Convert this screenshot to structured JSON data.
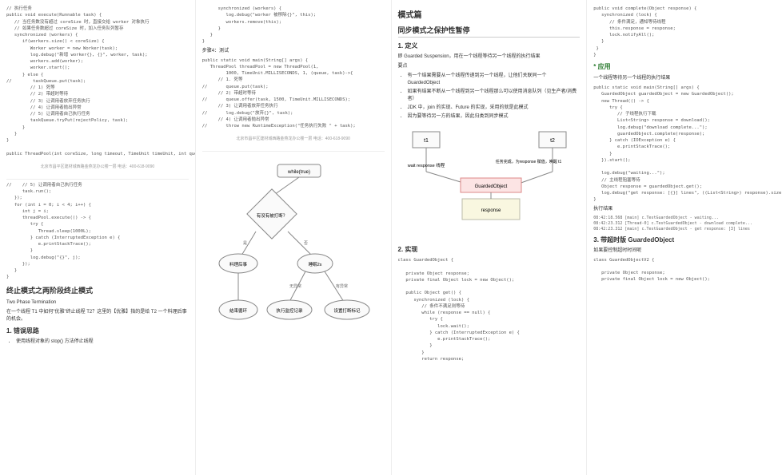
{
  "col1": {
    "code1": "// 执行任务\npublic void execute(Runnable task) {\n   // 当任务数没有超过 coreSize 时，直接交给 worker 对象执行\n   // 如果任务数超过 coreSize 时，加入任务队列暂存\n   synchronized (workers) {\n      if(workers.size() < coreSize) {\n         Worker worker = new Worker(task);\n         log.debug(\"新增 worker{}, {}\", worker, task);\n         workers.add(worker);\n         worker.start();\n      } else {\n//        taskQueue.put(task);\n         // 1) 死等\n         // 2) 带超时等待\n         // 3) 让调用者放弃任务执行\n         // 4) 让调用者抛出异常\n         // 5) 让调用者自己执行任务\n         taskQueue.tryPut(rejectPolicy, task);\n      }\n   }\n}\n\npublic ThreadPool(int coreSize, long timeout, TimeUnit timeUnit, int queueCapcity,",
    "footer1": "北京市昌平区建材城西路金燕龙办公楼一层   电话：400-618-9090",
    "code2": "//    // 5) 让调用者自己执行任务\n      task.run();\n   });\n   for (int i = 0; i < 4; i++) {\n      int j = i;\n      threadPool.execute(() -> {\n         try {\n            Thread.sleep(1000L);\n         } catch (InterruptedException e) {\n            e.printStackTrace();\n         }\n         log.debug(\"{}\", j);\n      });\n   }\n}",
    "h2_1": "终止模式之两阶段终止模式",
    "p1": "Two Phase Termination",
    "p2": "在一个线程 T1 中如何\"优雅\"终止线程 T2？这里的【优雅】指的是给 T2 一个料理后事的机会。",
    "h3_1": "1. 错误思路",
    "li1": "使用线程对象的 stop() 方法停止线程"
  },
  "col2": {
    "code1": "      synchronized (workers) {\n         log.debug(\"worker 被移除{}\", this);\n         workers.remove(this);\n      }\n   }\n}",
    "step": "步骤4：测试",
    "code2": "public static void main(String[] args) {\n   ThreadPool threadPool = new ThreadPool(1,\n         1000, TimeUnit.MILLISECONDS, 1, (queue, task)->{\n      // 1. 死等\n//       queue.put(task);\n      // 2) 带超时等待\n//       queue.offer(task, 1500, TimeUnit.MILLISECONDS);\n      // 3) 让调用者放弃任务执行\n//       log.debug(\"放弃{}\", task);\n      // 4) 让调用者抛出异常\n//       throw new RuntimeException(\"任务执行失败 \" + task);",
    "footer1": "北京市昌平区建材城西路金燕龙办公楼一层   电话：400-618-9090",
    "flow": {
      "top": "while(true)",
      "d1": "有没有被打断？",
      "yes": "是",
      "no": "否",
      "left": "料理后事",
      "right": "睡眠2s",
      "noex": "无异常",
      "hasex": "有异常",
      "b1": "结束循环",
      "b2": "执行监控记录",
      "b3": "设置打断标记"
    }
  },
  "col3": {
    "title": "模式篇",
    "sub1": "同步模式之保护性暂停",
    "h3_1": "1. 定义",
    "p1": "即 Guarded Suspension，用在一个线程等待另一个线程的执行结果",
    "p2": "要点",
    "li1": "有一个结果需要从一个线程传递到另一个线程，让他们关联同一个 GuardedObject",
    "li2": "如果有结果不断从一个线程到另一个线程那么可以使用消息队列（见生产者/消费者）",
    "li3": "JDK 中，join 的实现、Future 的实现，采用的就是此模式",
    "li4": "因为要等待另一方的结果，因此归类到同步模式",
    "diag": {
      "t1": "t1",
      "t2": "t2",
      "wait": "wait response 线程",
      "done": "任务完成，为response 赋值，唤醒 t1",
      "go": "GuardedObject",
      "resp": "response"
    },
    "h3_2": "2. 实现",
    "code1": "class GuardedObject {\n\n   private Object response;\n   private final Object lock = new Object();\n\n   public Object get() {\n      synchronized (lock) {\n         // 条件不满足则等待\n         while (response == null) {\n            try {\n               lock.wait();\n            } catch (InterruptedException e) {\n               e.printStackTrace();\n            }\n         }\n         return response;"
  },
  "col4": {
    "code1": "public void complete(Object response) {\n   synchronized (lock) {\n      // 条件满足，通知等待线程\n      this.response = response;\n      lock.notifyAll();\n   }\n }\n}",
    "accent": "* 应用",
    "p1": "一个线程等待另一个线程的执行结果",
    "code2": "public static void main(String[] args) {\n   GuardedObject guardedObject = new GuardedObject();\n   new Thread(() -> {\n      try {\n         // 子线程执行下载\n         List<String> response = download();\n         log.debug(\"download complete...\");\n         guardedObject.complete(response);\n      } catch (IOException e) {\n         e.printStackTrace();\n      }\n   }).start();\n\n   log.debug(\"waiting...\");\n   // 主线程阻塞等待\n   Object response = guardedObject.get();\n   log.debug(\"get response: [{}] lines\", ((List<String>) response).size());\n}",
    "p2": "执行结果",
    "log": "08:42:18.568 [main] c.TestGuardedObject - waiting...\n08:42:23.312 [Thread-0] c.TestGuardedObject - download complete...\n08:42:23.312 [main] c.TestGuardedObject - get response: [3] lines",
    "h3_1": "3. 带超时版 GuardedObject",
    "p3": "如果要控制超时时间呢",
    "code3": "class GuardedObjectV2 {\n\n   private Object response;\n   private final Object lock = new Object();"
  }
}
